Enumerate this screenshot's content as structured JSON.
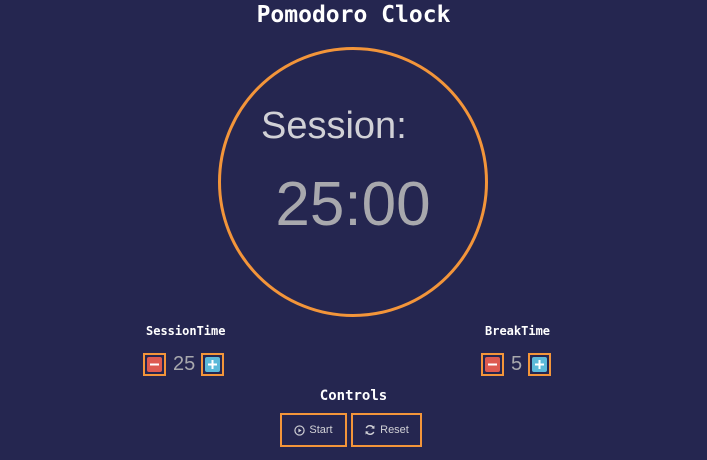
{
  "app": {
    "title": "Pomodoro Clock"
  },
  "clock": {
    "label": "Session:",
    "time": "25:00"
  },
  "session": {
    "title": "SessionTime",
    "value": "25"
  },
  "break": {
    "title": "BreakTime",
    "value": "5"
  },
  "controls": {
    "title": "Controls",
    "start_label": "Start",
    "reset_label": "Reset"
  },
  "icons": {
    "decrement": "minus-icon",
    "increment": "plus-icon",
    "start": "play-circle-icon",
    "reset": "refresh-icon"
  },
  "colors": {
    "background": "#252650",
    "accent": "#f3953a",
    "minus": "#dd5a50",
    "plus": "#5bb9d9"
  }
}
